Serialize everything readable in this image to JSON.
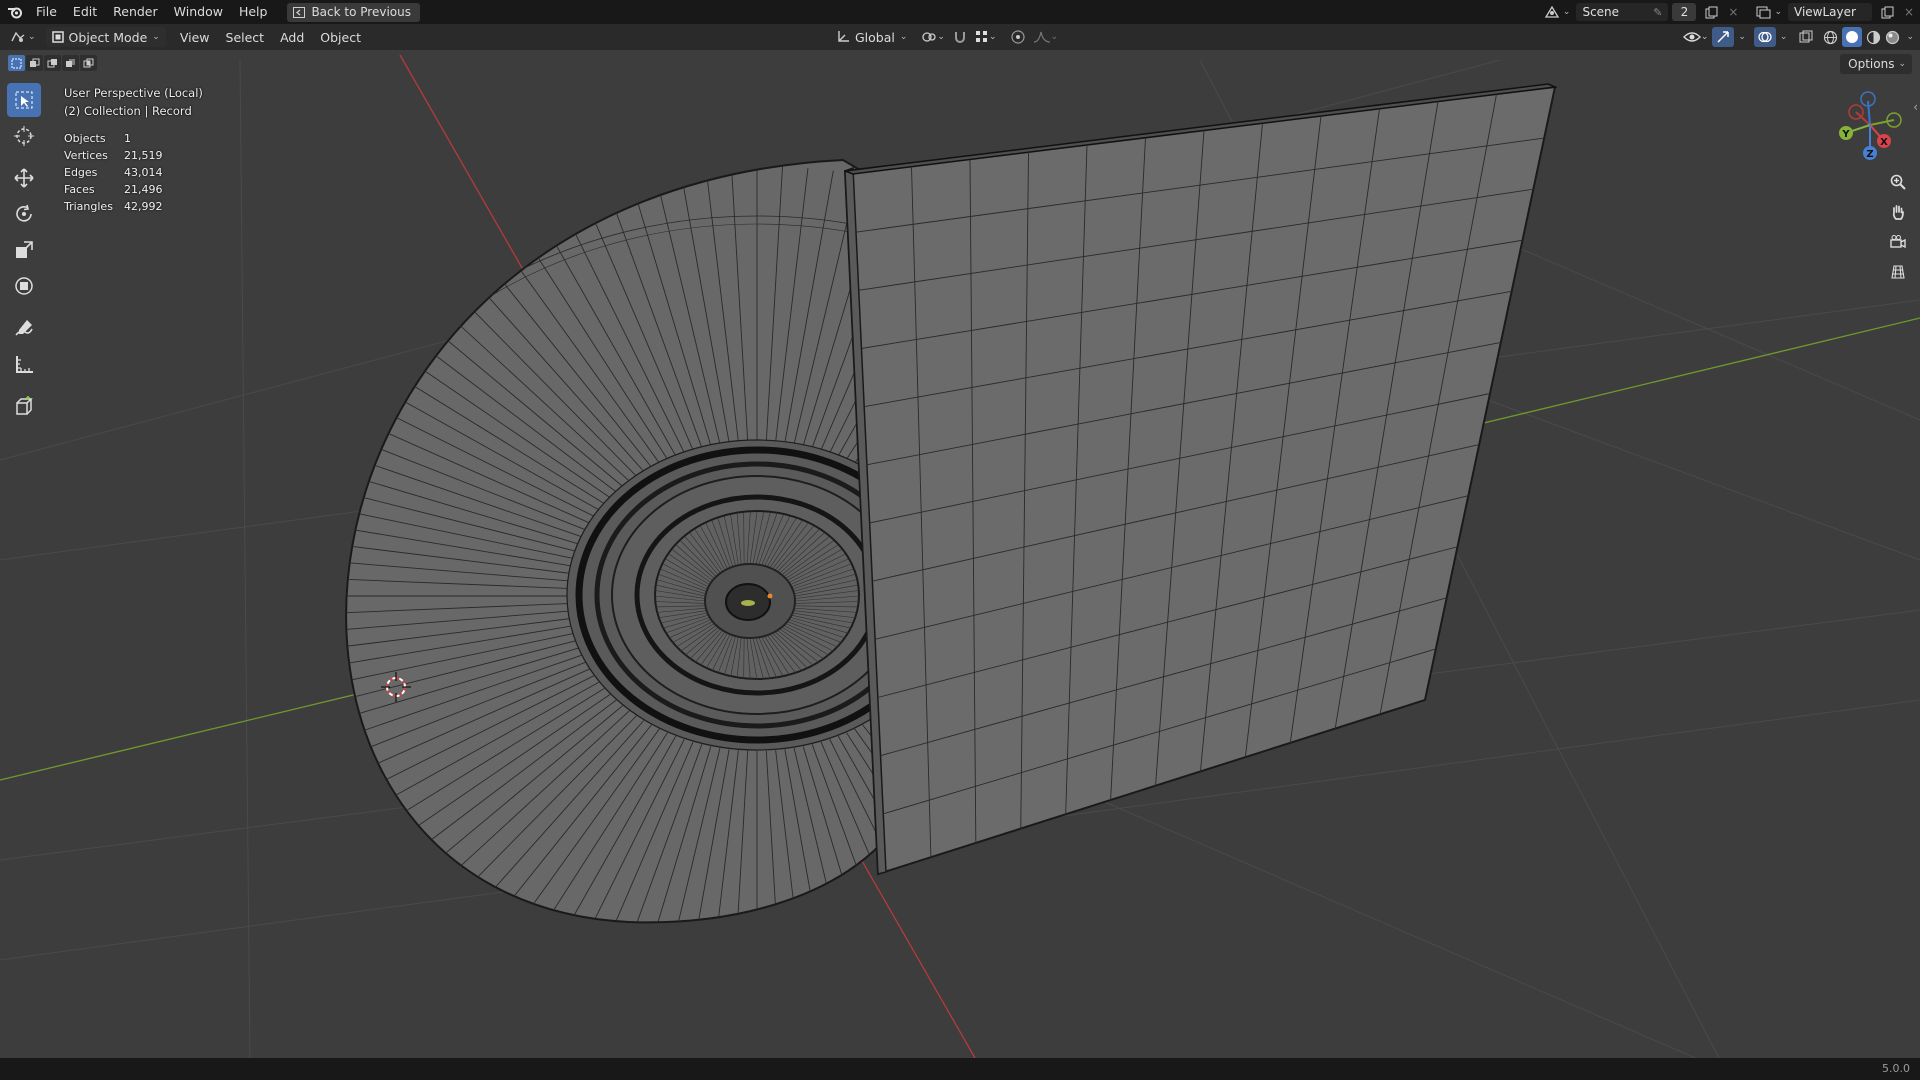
{
  "menubar": {
    "items": [
      "File",
      "Edit",
      "Render",
      "Window",
      "Help"
    ],
    "back_button": "Back to Previous",
    "scene": "Scene",
    "scene_users": "2",
    "view_layer": "ViewLayer"
  },
  "header": {
    "mode": "Object Mode",
    "menus": [
      "View",
      "Select",
      "Add",
      "Object"
    ],
    "orientation": "Global"
  },
  "overlay": {
    "view_name": "User Perspective (Local)",
    "collection": "(2) Collection | Record",
    "stats": [
      {
        "label": "Objects",
        "value": "1"
      },
      {
        "label": "Vertices",
        "value": "21,519"
      },
      {
        "label": "Edges",
        "value": "43,014"
      },
      {
        "label": "Faces",
        "value": "21,496"
      },
      {
        "label": "Triangles",
        "value": "42,992"
      }
    ]
  },
  "options_label": "Options",
  "gizmo": {
    "x": "X",
    "y": "Y",
    "z": "Z"
  },
  "version": "5.0.0",
  "colors": {
    "viewport_bg": "#3d3d3d",
    "accent": "#4772b3",
    "x_axis": "#c23a3a",
    "y_axis": "#7aa22f",
    "z_axis": "#3b74c4"
  },
  "tools": [
    "select-box-tool",
    "cursor-tool",
    "move-tool",
    "rotate-tool",
    "scale-tool",
    "transform-tool",
    "annotate-tool",
    "measure-tool",
    "add-cube-tool"
  ]
}
